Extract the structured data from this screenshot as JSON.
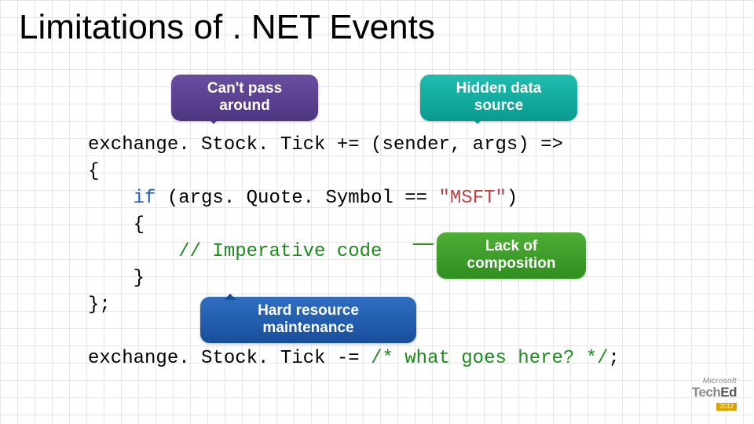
{
  "title": "Limitations of . NET Events",
  "bubbles": {
    "cant": "Can't pass around",
    "hidden": "Hidden data source",
    "lack": "Lack of composition",
    "hard": "Hard resource maintenance"
  },
  "code": {
    "line1_a": "exchange. Stock. Tick += (sender, args) =>",
    "line2": "{",
    "line3_a": "    ",
    "line3_if": "if",
    "line3_b": " (args. Quote. Symbol == ",
    "line3_str": "\"MSFT\"",
    "line3_c": ")",
    "line4": "    {",
    "line5_a": "        ",
    "line5_cmt": "// Imperative code",
    "line6": "    }",
    "line7": "};",
    "blank": "",
    "line8_a": "exchange. Stock. Tick -= ",
    "line8_cmt": "/* what goes here? */",
    "line8_b": ";"
  },
  "footer": {
    "company": "Microsoft",
    "brand_a": "Tech",
    "brand_b": "Ed",
    "year": "2012"
  }
}
